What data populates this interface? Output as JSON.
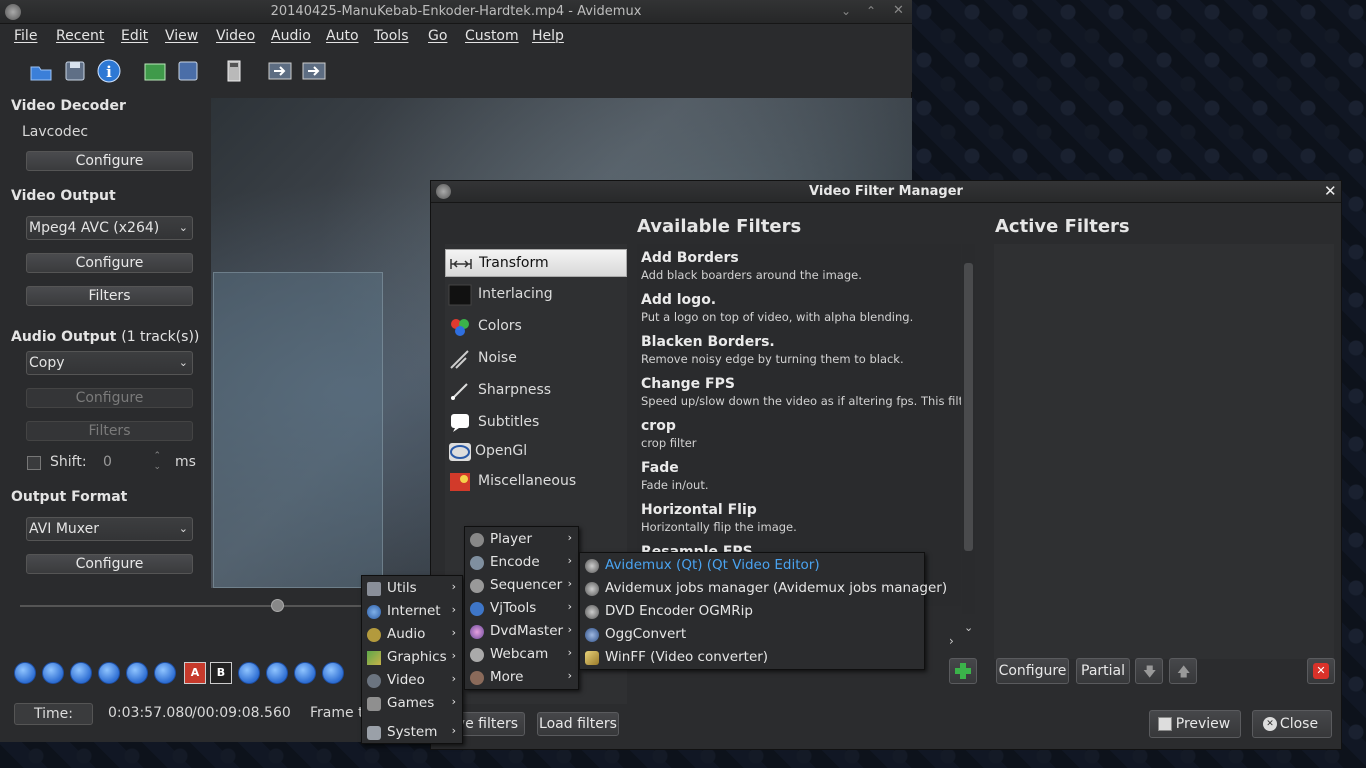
{
  "main_window": {
    "title": "20140425-ManuKebab-Enkoder-Hardtek.mp4 - Avidemux",
    "menus": [
      "File",
      "Recent",
      "Edit",
      "View",
      "Video",
      "Audio",
      "Auto",
      "Tools",
      "Go",
      "Custom",
      "Help"
    ],
    "toolbar_icons": [
      "open-icon",
      "save-icon",
      "info-icon",
      "open-folder-icon",
      "save-video-icon",
      "calculator-icon",
      "first-frame-icon",
      "last-frame-icon"
    ],
    "video_decoder": {
      "heading": "Video Decoder",
      "codec": "Lavcodec",
      "configure": "Configure"
    },
    "video_output": {
      "heading": "Video Output",
      "selected": "Mpeg4 AVC (x264)",
      "configure": "Configure",
      "filters": "Filters"
    },
    "audio_output": {
      "heading": "Audio Output",
      "tracks": "(1 track(s))",
      "selected": "Copy",
      "configure": "Configure",
      "filters": "Filters",
      "shift_label": "Shift:",
      "shift_value": "0",
      "shift_unit": "ms"
    },
    "output_format": {
      "heading": "Output Format",
      "selected": "AVI Muxer",
      "configure": "Configure"
    },
    "time": {
      "label": "Time:",
      "current": "0:03:57.080",
      "total": "/00:09:08.560",
      "frame_type": "Frame ty"
    }
  },
  "dialog": {
    "title": "Video Filter Manager",
    "available_heading": "Available Filters",
    "active_heading": "Active Filters",
    "categories": [
      {
        "label": "Transform",
        "icon": "transform-icon"
      },
      {
        "label": "Interlacing",
        "icon": "interlacing-icon"
      },
      {
        "label": "Colors",
        "icon": "colors-icon"
      },
      {
        "label": "Noise",
        "icon": "noise-icon"
      },
      {
        "label": "Sharpness",
        "icon": "sharpness-icon"
      },
      {
        "label": "Subtitles",
        "icon": "subtitles-icon"
      },
      {
        "label": "OpenGl",
        "icon": "opengl-icon"
      },
      {
        "label": "Miscellaneous",
        "icon": "miscellaneous-icon"
      }
    ],
    "filters": [
      {
        "name": "Add Borders",
        "desc": "Add black boarders around the image."
      },
      {
        "name": "Add logo.",
        "desc": "Put a logo on top of video, with alpha blending."
      },
      {
        "name": "Blacken Borders.",
        "desc": "Remove noisy edge by turning them to black."
      },
      {
        "name": "Change FPS",
        "desc": "Speed up/slow down the video as if altering fps. This filter c"
      },
      {
        "name": "crop",
        "desc": "crop filter"
      },
      {
        "name": "Fade",
        "desc": "Fade in/out."
      },
      {
        "name": "Horizontal Flip",
        "desc": "Horizontally flip the image."
      },
      {
        "name": "Resample FPS",
        "desc": ""
      }
    ],
    "buttons": {
      "configure": "Configure",
      "partial": "Partial",
      "save_filters": "ve filters",
      "load_filters": "Load filters",
      "preview": "Preview",
      "close": "Close"
    }
  },
  "app_menu": {
    "categories": [
      "Utils",
      "Internet",
      "Audio",
      "Graphics",
      "Video",
      "Games",
      "System"
    ],
    "video_submenu": [
      "Player",
      "Encode",
      "Sequencer",
      "VjTools",
      "DvdMaster",
      "Webcam",
      "More"
    ],
    "encode_submenu": [
      "Avidemux (Qt) (Qt Video Editor)",
      "Avidemux jobs manager (Avidemux jobs manager)",
      "DVD Encoder OGMRip",
      "OggConvert",
      "WinFF (Video converter)"
    ]
  },
  "colors": {
    "highlight": "#4aa3f0",
    "bg": "#2b2c2e"
  }
}
